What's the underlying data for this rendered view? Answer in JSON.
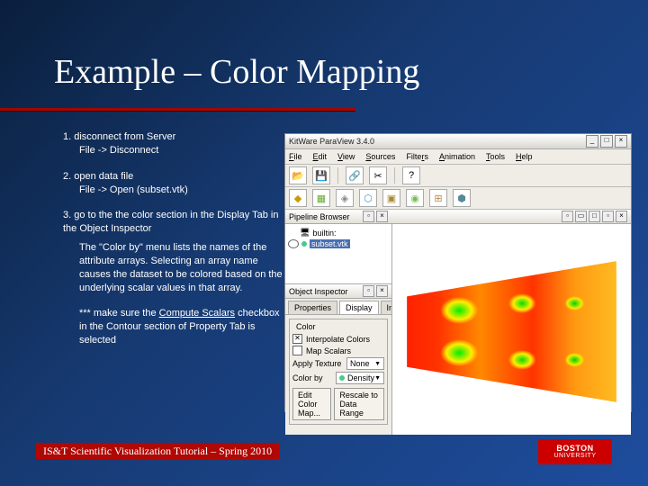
{
  "title": "Example – Color Mapping",
  "steps": {
    "s1": "1. disconnect from Server",
    "s1a": "File -> Disconnect",
    "s2": "2. open data file",
    "s2a": "File -> Open (subset.vtk)",
    "s3": "3. go to the the color section in the Display Tab in the Object Inspector",
    "s3a": "The \"Color by\" menu lists the names of the attribute arrays. Selecting an array name causes the dataset to be colored based on the underlying scalar values in that array.",
    "note1": "*** make sure the ",
    "noteU": "Compute Scalars",
    "note2": " checkbox in the Contour section of Property Tab is selected"
  },
  "app": {
    "title": "KitWare ParaView 3.4.0",
    "menus": {
      "file": "File",
      "edit": "Edit",
      "view": "View",
      "sources": "Sources",
      "filters": "Filters",
      "animation": "Animation",
      "tools": "Tools",
      "help": "Help"
    },
    "pipeline": {
      "title": "Pipeline Browser",
      "root": "builtin:",
      "item": "subset.vtk"
    },
    "inspector": {
      "title": "Object Inspector",
      "tabs": {
        "p": "Properties",
        "d": "Display",
        "i": "Information"
      }
    },
    "color": {
      "grp": "Color",
      "interp": "Interpolate Colors",
      "map": "Map Scalars",
      "applyTex": "Apply Texture",
      "texVal": "None",
      "colorBy": "Color by",
      "colorVal": "Density",
      "editMap": "Edit Color Map...",
      "rescale": "Rescale to Data Range"
    }
  },
  "footer": "IS&T Scientific Visualization Tutorial – Spring 2010",
  "logo": {
    "a": "BOSTON",
    "b": "UNIVERSITY"
  }
}
